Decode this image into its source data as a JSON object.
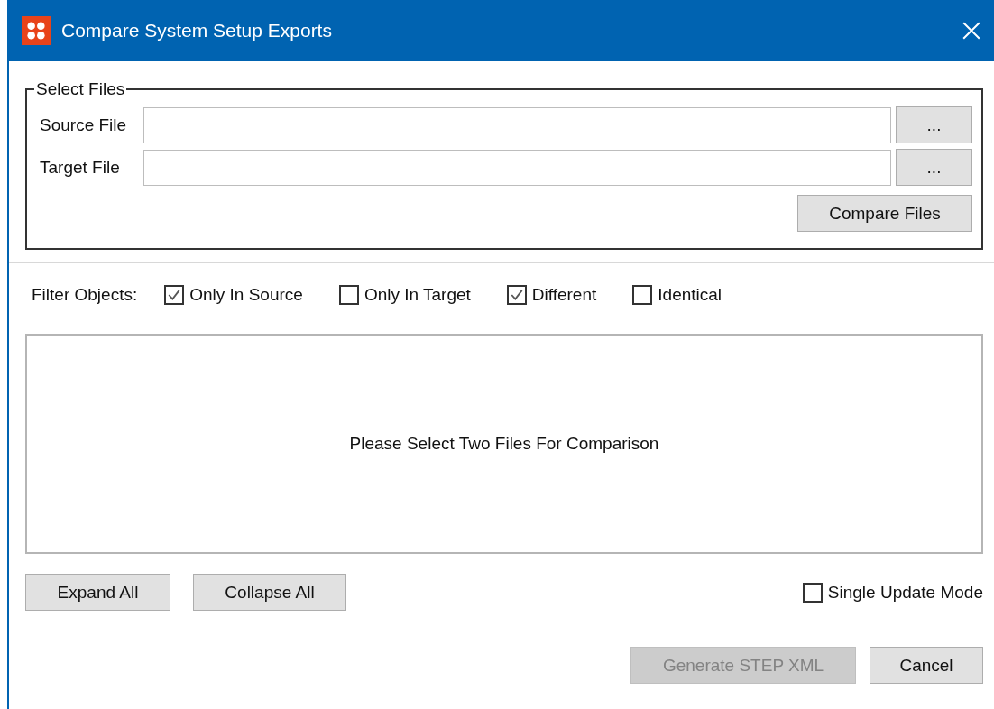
{
  "window": {
    "title": "Compare System Setup Exports"
  },
  "select_files": {
    "legend": "Select Files",
    "fields": [
      {
        "label": "Source File",
        "browse": "..."
      },
      {
        "label": "Target File",
        "browse": "..."
      }
    ],
    "compare_button": {
      "label": "Compare Files",
      "disabled": false
    }
  },
  "filter": {
    "label": "Filter Objects:",
    "options": [
      {
        "label": "Only In Source",
        "checked": true
      },
      {
        "label": "Only In Target",
        "checked": false
      },
      {
        "label": "Different",
        "checked": true
      },
      {
        "label": "Identical",
        "checked": false
      }
    ]
  },
  "results": {
    "message": "Please Select Two Files For Comparison"
  },
  "tree_buttons": [
    {
      "label": "Expand All",
      "disabled": false
    },
    {
      "label": "Collapse All",
      "disabled": false
    }
  ],
  "single_update_mode": {
    "label": "Single Update Mode",
    "checked": false
  },
  "footer_buttons": [
    {
      "label": "Generate STEP XML",
      "disabled": true
    },
    {
      "label": "Cancel",
      "disabled": false
    }
  ]
}
